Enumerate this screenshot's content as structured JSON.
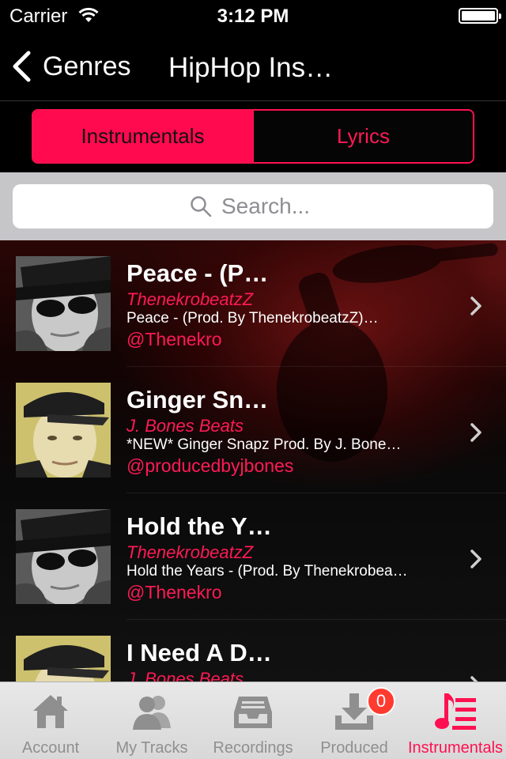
{
  "status_bar": {
    "carrier": "Carrier",
    "time": "3:12 PM",
    "wifi_icon": "wifi-icon",
    "battery_icon": "battery-full-icon"
  },
  "nav": {
    "back_label": "Genres",
    "title": "HipHop Ins…"
  },
  "segments": {
    "items": [
      {
        "label": "Instrumentals",
        "selected": true
      },
      {
        "label": "Lyrics",
        "selected": false
      }
    ],
    "accent": "#ff0a4f"
  },
  "search": {
    "placeholder": "Search..."
  },
  "tracks": [
    {
      "title": "Peace - (P…",
      "producer": "ThenekrobeatzZ",
      "description": "Peace - (Prod. By ThenekrobeatzZ)…",
      "handle": "@Thenekro",
      "thumb": "avatar-sunglasses"
    },
    {
      "title": "Ginger Sn…",
      "producer": "J. Bones Beats",
      "description": "*NEW* Ginger Snapz Prod. By J. Bone…",
      "handle": "@producedbyjbones",
      "thumb": "avatar-cap"
    },
    {
      "title": "Hold the Y…",
      "producer": "ThenekrobeatzZ",
      "description": "Hold the Years - (Prod. By Thenekrobea…",
      "handle": "@Thenekro",
      "thumb": "avatar-sunglasses"
    },
    {
      "title": "I Need A D…",
      "producer": "J. Bones Beats",
      "description": "",
      "handle": "",
      "thumb": "avatar-cap"
    }
  ],
  "tab_bar": {
    "items": [
      {
        "label": "Account",
        "icon": "house-icon",
        "active": false
      },
      {
        "label": "My Tracks",
        "icon": "users-icon",
        "active": false
      },
      {
        "label": "Recordings",
        "icon": "inbox-tray-icon",
        "active": false
      },
      {
        "label": "Produced",
        "icon": "download-icon",
        "active": false,
        "badge": "0"
      },
      {
        "label": "Instrumentals",
        "icon": "music-list-icon",
        "active": true
      }
    ],
    "active_color": "#ff1050",
    "inactive_color": "#8f8f8f"
  }
}
